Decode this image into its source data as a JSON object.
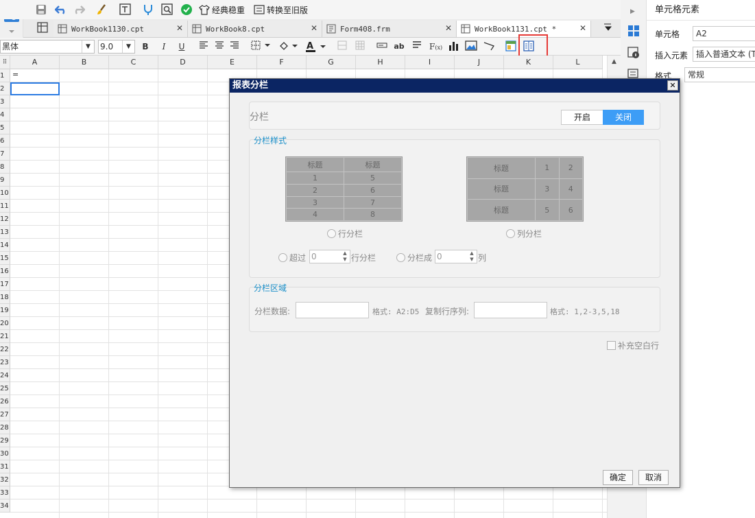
{
  "toolbar": {
    "classic_stable": "经典稳重",
    "switch_old": "转换至旧版"
  },
  "file_tabs": [
    {
      "name": "WorkBook1130.cpt"
    },
    {
      "name": "WorkBook8.cpt"
    },
    {
      "name": "Form408.frm"
    },
    {
      "name": "WorkBook1131.cpt *"
    }
  ],
  "format_bar": {
    "font_name": "黑体",
    "font_size": "9.0"
  },
  "columns": [
    "A",
    "B",
    "C",
    "D",
    "E",
    "F",
    "G",
    "H",
    "I",
    "J",
    "K",
    "L"
  ],
  "rows": [
    "1",
    "2",
    "3",
    "4",
    "5",
    "6",
    "7",
    "8",
    "9",
    "10",
    "11",
    "12",
    "13",
    "14",
    "15",
    "16",
    "17",
    "18",
    "19",
    "20",
    "21",
    "22",
    "23",
    "24",
    "25",
    "26",
    "27",
    "28",
    "29",
    "30",
    "31",
    "32",
    "33",
    "34"
  ],
  "cells": {
    "A1": "="
  },
  "right_panel": {
    "title": "单元格元素",
    "cell_label": "单元格",
    "cell_value": "A2",
    "insert_label": "插入元素",
    "insert_value": "插入普通文本 (T",
    "format_label": "格式",
    "format_value": "常规"
  },
  "dialog": {
    "title": "报表分栏",
    "column_label": "分栏",
    "toggle_on": "开启",
    "toggle_off": "关闭",
    "section_style": "分栏样式",
    "section_area": "分栏区域",
    "row_preview": {
      "header": [
        "标题",
        "标题"
      ],
      "rows": [
        [
          "1",
          "5"
        ],
        [
          "2",
          "6"
        ],
        [
          "3",
          "7"
        ],
        [
          "4",
          "8"
        ]
      ]
    },
    "col_preview": {
      "rows": [
        [
          "标题",
          "1",
          "2"
        ],
        [
          "标题",
          "3",
          "4"
        ],
        [
          "标题",
          "5",
          "6"
        ]
      ]
    },
    "row_column_label": "行分栏",
    "col_column_label": "列分栏",
    "exceed_label": "超过",
    "exceed_value": "0",
    "exceed_suffix": "行分栏",
    "split_into_label": "分栏成",
    "split_into_value": "0",
    "split_into_suffix": "列",
    "data_label": "分栏数据:",
    "data_format": "格式: A2:D5",
    "copy_label": "复制行序列:",
    "copy_format": "格式: 1,2-3,5,18",
    "fill_blank": "补充空白行",
    "ok": "确定",
    "cancel": "取消"
  }
}
